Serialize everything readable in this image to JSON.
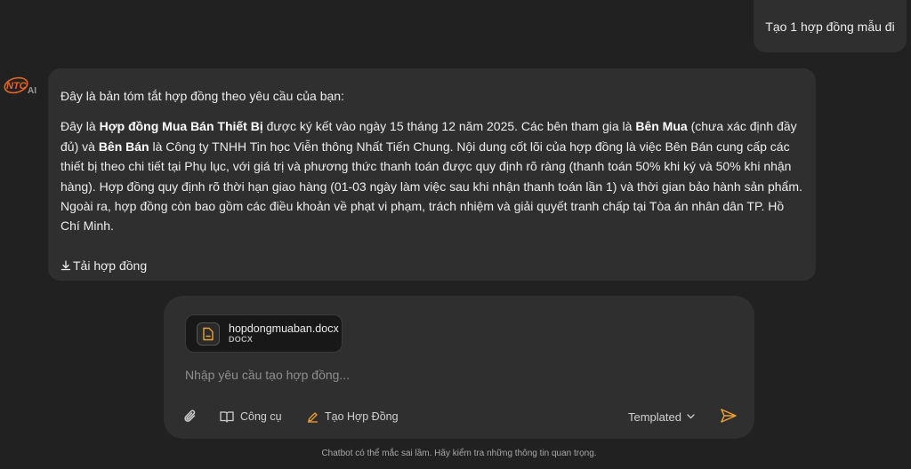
{
  "user_message": {
    "text": "Tạo 1 hợp đồng mẫu đi"
  },
  "bot": {
    "avatar_logo": "NTC",
    "avatar_suffix": "AI",
    "intro": "Đây là bản tóm tắt hợp đồng theo yêu cầu của bạn:",
    "summary": {
      "p1": "Đây là ",
      "contract_name": "Hợp đồng Mua Bán Thiết Bị",
      "p2": " được ký kết vào ngày 15 tháng 12 năm 2025. Các bên tham gia là ",
      "buyer": "Bên Mua",
      "p3": " (chưa xác định đầy đủ) và ",
      "seller": "Bên Bán",
      "p4": " là Công ty TNHH Tin học Viễn thông Nhất Tiến Chung. Nội dung cốt lõi của hợp đồng là việc Bên Bán cung cấp các thiết bị theo chi tiết tại Phụ lục, với giá trị và phương thức thanh toán được quy định rõ ràng (thanh toán 50% khi ký và 50% khi nhận hàng). Hợp đồng quy định rõ thời hạn giao hàng (01-03 ngày làm việc sau khi nhận thanh toán lần 1) và thời gian bảo hành sản phẩm. Ngoài ra, hợp đồng còn bao gồm các điều khoản về phạt vi phạm, trách nhiệm và giải quyết tranh chấp tại Tòa án nhân dân TP. Hồ Chí Minh."
    },
    "download_label": "Tải hợp đồng"
  },
  "composer": {
    "file": {
      "name": "hopdongmuaban.docx",
      "type": "DOCX"
    },
    "placeholder": "Nhập yêu cầu tạo hợp đồng...",
    "tools_label": "Công cụ",
    "create_label": "Tạo Hợp Đồng",
    "mode_label": "Templated"
  },
  "disclaimer": "Chatbot có thể mắc sai lầm. Hãy kiểm tra những thông tin quan trọng.",
  "colors": {
    "background": "#212121",
    "bubble": "#2f2f2f",
    "accent_orange": "#f0a030",
    "logo_orange": "#e8641e"
  },
  "icons": [
    "paperclip-icon",
    "book-icon",
    "pencil-icon",
    "chevron-down-icon",
    "send-icon",
    "download-icon",
    "file-icon"
  ]
}
